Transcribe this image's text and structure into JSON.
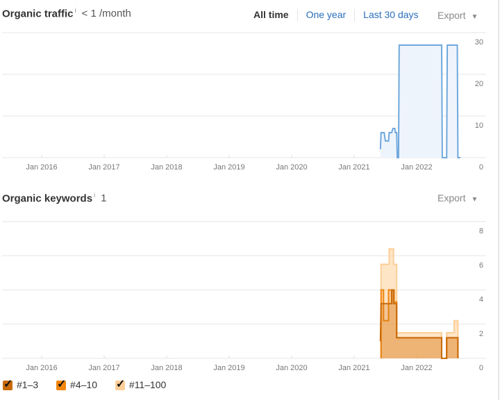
{
  "traffic": {
    "title": "Organic traffic",
    "info_icon": "i",
    "metric": "< 1 /month",
    "ranges": [
      {
        "label": "All time",
        "selected": true
      },
      {
        "label": "One year",
        "selected": false
      },
      {
        "label": "Last 30 days",
        "selected": false
      }
    ],
    "export_label": "Export"
  },
  "keywords": {
    "title": "Organic keywords",
    "info_icon": "i",
    "metric": "1",
    "export_label": "Export"
  },
  "legend": [
    {
      "label": "#1–3",
      "color": "#c96a0a",
      "checked": true
    },
    {
      "label": "#4–10",
      "color": "#f2870f",
      "checked": true
    },
    {
      "label": "#11–100",
      "color": "#fdcf98",
      "checked": true
    }
  ],
  "colors": {
    "traffic_line": "#6fa8dc",
    "traffic_fill": "#eef4fc",
    "kw_1_3": "#c96a0a",
    "kw_4_10": "#f2870f",
    "kw_11_100": "#fdcf98",
    "grid": "#e6e6e6"
  },
  "chart_data": [
    {
      "type": "area",
      "title": "Organic traffic",
      "x_ticks": [
        "Jan 2016",
        "Jan 2017",
        "Jan 2018",
        "Jan 2019",
        "Jan 2020",
        "Jan 2021",
        "Jan 2022"
      ],
      "y_ticks": [
        0,
        10,
        20,
        30
      ],
      "ylim": [
        0,
        30
      ],
      "xlim": [
        2015.4,
        2023.1
      ],
      "grid": true,
      "series": [
        {
          "name": "Organic traffic",
          "points": [
            [
              2021.42,
              2
            ],
            [
              2021.43,
              6
            ],
            [
              2021.48,
              6
            ],
            [
              2021.5,
              4
            ],
            [
              2021.55,
              4
            ],
            [
              2021.56,
              6
            ],
            [
              2021.6,
              6
            ],
            [
              2021.62,
              7
            ],
            [
              2021.65,
              7
            ],
            [
              2021.66,
              6
            ],
            [
              2021.68,
              6
            ],
            [
              2021.69,
              0
            ],
            [
              2021.71,
              0
            ],
            [
              2021.72,
              27
            ],
            [
              2022.4,
              27
            ],
            [
              2022.41,
              0
            ],
            [
              2022.48,
              0
            ],
            [
              2022.49,
              27
            ],
            [
              2022.65,
              27
            ],
            [
              2022.66,
              0
            ],
            [
              2022.7,
              0
            ]
          ]
        }
      ]
    },
    {
      "type": "area",
      "title": "Organic keywords",
      "x_ticks": [
        "Jan 2016",
        "Jan 2017",
        "Jan 2018",
        "Jan 2019",
        "Jan 2020",
        "Jan 2021",
        "Jan 2022"
      ],
      "y_ticks": [
        0,
        2,
        4,
        6,
        8
      ],
      "ylim": [
        0,
        8
      ],
      "xlim": [
        2015.4,
        2023.1
      ],
      "grid": true,
      "series": [
        {
          "name": "#11–100",
          "points": [
            [
              2021.43,
              0
            ],
            [
              2021.43,
              5.5
            ],
            [
              2021.56,
              5.5
            ],
            [
              2021.56,
              6.4
            ],
            [
              2021.63,
              6.4
            ],
            [
              2021.63,
              5.5
            ],
            [
              2021.68,
              5.5
            ],
            [
              2021.68,
              1.5
            ],
            [
              2022.4,
              1.5
            ],
            [
              2022.4,
              0
            ],
            [
              2022.48,
              0
            ],
            [
              2022.48,
              1.5
            ],
            [
              2022.6,
              1.5
            ],
            [
              2022.6,
              2.2
            ],
            [
              2022.66,
              2.2
            ],
            [
              2022.66,
              0
            ]
          ]
        },
        {
          "name": "#4–10",
          "points": [
            [
              2021.43,
              0
            ],
            [
              2021.43,
              4
            ],
            [
              2021.47,
              4
            ],
            [
              2021.47,
              2.2
            ],
            [
              2021.55,
              2.2
            ],
            [
              2021.55,
              4
            ],
            [
              2021.64,
              4
            ],
            [
              2021.64,
              3.3
            ],
            [
              2021.68,
              3.3
            ],
            [
              2021.68,
              1.2
            ],
            [
              2022.4,
              1.2
            ],
            [
              2022.4,
              0
            ],
            [
              2022.48,
              0
            ],
            [
              2022.48,
              1.2
            ],
            [
              2022.66,
              1.2
            ],
            [
              2022.66,
              0
            ]
          ]
        },
        {
          "name": "#1–3",
          "points": [
            [
              2021.42,
              1
            ],
            [
              2021.43,
              3.2
            ],
            [
              2021.55,
              3.2
            ],
            [
              2021.55,
              3.2
            ],
            [
              2021.6,
              3.2
            ],
            [
              2021.6,
              4
            ],
            [
              2021.63,
              4
            ],
            [
              2021.63,
              3.2
            ],
            [
              2021.68,
              3.2
            ],
            [
              2021.68,
              1.2
            ],
            [
              2022.4,
              1.2
            ],
            [
              2022.4,
              0
            ],
            [
              2022.48,
              0
            ],
            [
              2022.48,
              1.2
            ],
            [
              2022.66,
              1.2
            ],
            [
              2022.66,
              0
            ]
          ]
        }
      ]
    }
  ]
}
